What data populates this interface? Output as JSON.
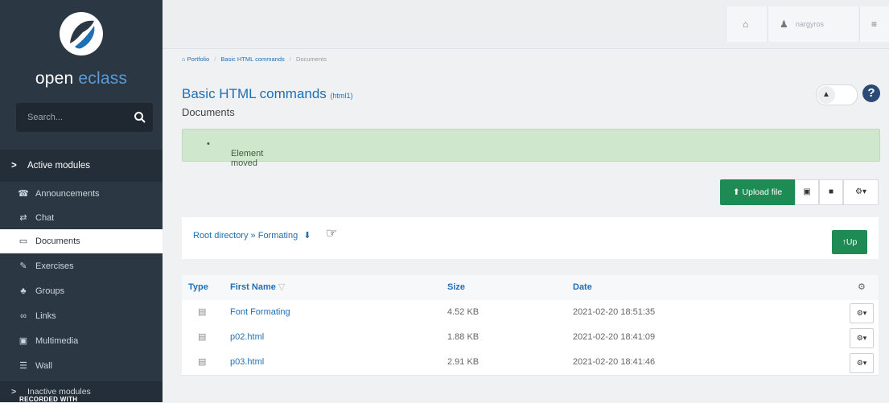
{
  "sidebar": {
    "logo_text_main": "open ",
    "logo_text_accent": "eclass",
    "search_placeholder": "Search...",
    "active_section": "Active modules",
    "items": [
      {
        "label": "Announcements",
        "icon": "megaphone-icon",
        "glyph": "☎"
      },
      {
        "label": "Chat",
        "icon": "exchange-icon",
        "glyph": "⇄"
      },
      {
        "label": "Documents",
        "icon": "folder-open-icon",
        "glyph": "▭"
      },
      {
        "label": "Exercises",
        "icon": "edit-icon",
        "glyph": "✎"
      },
      {
        "label": "Groups",
        "icon": "users-icon",
        "glyph": "♣"
      },
      {
        "label": "Links",
        "icon": "link-icon",
        "glyph": "∞"
      },
      {
        "label": "Multimedia",
        "icon": "film-icon",
        "glyph": "▣"
      },
      {
        "label": "Wall",
        "icon": "list-icon",
        "glyph": "☰"
      }
    ],
    "inactive_section": "Inactive modules",
    "watermark": "RECORDED WITH"
  },
  "topbar": {
    "home_icon": "home-icon",
    "user_label": "nargyros",
    "settings_icon": "sliders-icon"
  },
  "breadcrumb": [
    "Portfolio",
    "Basic HTML commands",
    "Documents"
  ],
  "page": {
    "title": "Basic HTML commands",
    "code": "(html1)",
    "subtitle": "Documents"
  },
  "alert": {
    "message": "Element moved"
  },
  "actions": {
    "upload_label": "Upload file",
    "up_label": "Up"
  },
  "path": {
    "root": "Root directory",
    "sep": " » ",
    "current": "Formating"
  },
  "table": {
    "headers": {
      "type": "Type",
      "name": "First Name",
      "size": "Size",
      "date": "Date"
    },
    "rows": [
      {
        "name": "Font Formating",
        "size": "4.52 KB",
        "date": "2021-02-20 18:51:35"
      },
      {
        "name": "p02.html",
        "size": "1.88 KB",
        "date": "2021-02-20 18:41:09"
      },
      {
        "name": "p03.html",
        "size": "2.91 KB",
        "date": "2021-02-20 18:41:46"
      }
    ]
  },
  "colors": {
    "sidebar": "#2b3743",
    "brand_blue": "#1f6fb5",
    "success": "#1e8b54",
    "alert_bg": "#cfe8cd"
  }
}
